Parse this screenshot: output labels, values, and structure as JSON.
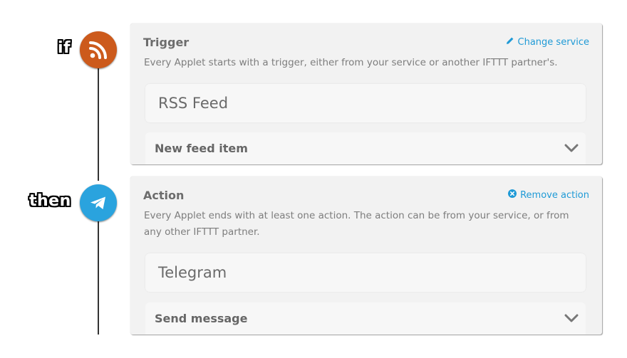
{
  "trigger": {
    "step_label": "if",
    "icon": "rss-icon",
    "icon_color": "#cc5a1c",
    "title": "Trigger",
    "link_label": "Change service",
    "description": "Every Applet starts with a trigger, either from your service or another IFTTT partner's.",
    "service_name": "RSS Feed",
    "selected_option": "New feed item"
  },
  "action": {
    "step_label": "then",
    "icon": "telegram-icon",
    "icon_color": "#2aa3de",
    "title": "Action",
    "link_label": "Remove action",
    "description": "Every Applet ends with at least one action. The action can be from your service, or from any other IFTTT partner.",
    "service_name": "Telegram",
    "selected_option": "Send message"
  },
  "colors": {
    "accent_link": "#1f9ad6",
    "card_bg": "#f2f2f2"
  }
}
